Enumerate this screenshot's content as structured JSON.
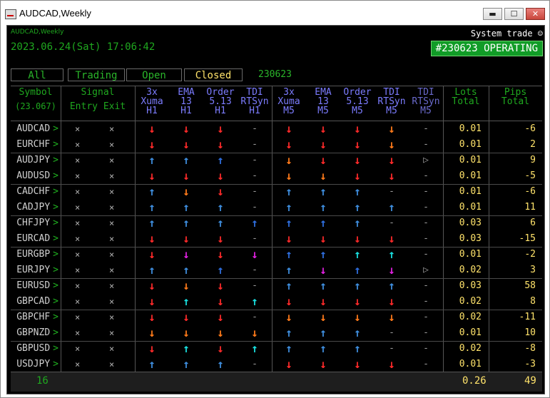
{
  "window": {
    "title": "AUDCAD,Weekly",
    "minimize": "▬",
    "maximize": "☐",
    "close": "✕"
  },
  "panel": {
    "symbol": "AUDCAD,Weekly",
    "datetime": "2023.06.24(Sat) 17:06:42",
    "system_trade": "System trade ☺",
    "operating": "#230623 OPERATING",
    "filters": [
      "All",
      "Trading",
      "Open",
      "Closed"
    ],
    "active_filter": "Closed",
    "filter_date": "230623"
  },
  "headers": {
    "symbol": [
      "Symbol",
      "(23.067)"
    ],
    "signal": [
      "Signal",
      "Entry  Exit"
    ],
    "h1": [
      [
        "3x",
        "Xuma",
        "H1"
      ],
      [
        "EMA",
        "13",
        "H1"
      ],
      [
        "Order",
        "5.13",
        "H1"
      ],
      [
        "TDI",
        "RTSyn",
        "H1"
      ]
    ],
    "m5": [
      [
        "3x",
        "Xuma",
        "M5"
      ],
      [
        "EMA",
        "13",
        "M5"
      ],
      [
        "Order",
        "5.13",
        "M5"
      ],
      [
        "TDI",
        "RTSyn",
        "M5"
      ],
      [
        "TDI",
        "RTSyn",
        "M5"
      ]
    ],
    "lots": [
      "Lots",
      "Total"
    ],
    "pips": [
      "Pips",
      "Total"
    ]
  },
  "colors": {
    "red": "#ff2a2a",
    "orange": "#ff7a1a",
    "blue": "#2f6fe0",
    "lblue": "#3f8fe0",
    "cyan": "#19e0e0",
    "magenta": "#e020e0",
    "gray": "#9a9a9a",
    "green": "#1fa81f",
    "yellow": "#ffe36b"
  },
  "rows": [
    {
      "symbol": "AUDCAD",
      "entry": "×",
      "exit": "×",
      "h1": [
        "red:↓",
        "red:↓",
        "red:↓",
        "gray:-"
      ],
      "m5": [
        "red:↓",
        "red:↓",
        "red:↓",
        "orange:↓",
        "gray:-"
      ],
      "lots": "0.01",
      "pips": "-6"
    },
    {
      "symbol": "EURCHF",
      "entry": "×",
      "exit": "×",
      "h1": [
        "red:↓",
        "red:↓",
        "red:↓",
        "gray:-"
      ],
      "m5": [
        "red:↓",
        "red:↓",
        "red:↓",
        "orange:↓",
        "gray:-"
      ],
      "lots": "0.01",
      "pips": "2"
    },
    {
      "symbol": "AUDJPY",
      "entry": "×",
      "exit": "×",
      "h1": [
        "lblue:↑",
        "lblue:↑",
        "blue:↑",
        "gray:-"
      ],
      "m5": [
        "orange:↓",
        "red:↓",
        "red:↓",
        "red:↓",
        "gray:▷"
      ],
      "lots": "0.01",
      "pips": "9"
    },
    {
      "symbol": "AUDUSD",
      "entry": "×",
      "exit": "×",
      "h1": [
        "red:↓",
        "red:↓",
        "red:↓",
        "gray:-"
      ],
      "m5": [
        "orange:↓",
        "orange:↓",
        "red:↓",
        "red:↓",
        "gray:-"
      ],
      "lots": "0.01",
      "pips": "-5"
    },
    {
      "symbol": "CADCHF",
      "entry": "×",
      "exit": "×",
      "h1": [
        "lblue:↑",
        "orange:↓",
        "red:↓",
        "gray:-"
      ],
      "m5": [
        "lblue:↑",
        "lblue:↑",
        "lblue:↑",
        "gray:-",
        "gray:-"
      ],
      "lots": "0.01",
      "pips": "-6"
    },
    {
      "symbol": "CADJPY",
      "entry": "×",
      "exit": "×",
      "h1": [
        "lblue:↑",
        "lblue:↑",
        "lblue:↑",
        "gray:-"
      ],
      "m5": [
        "lblue:↑",
        "lblue:↑",
        "lblue:↑",
        "lblue:↑",
        "gray:-"
      ],
      "lots": "0.01",
      "pips": "11"
    },
    {
      "symbol": "CHFJPY",
      "entry": "×",
      "exit": "×",
      "h1": [
        "lblue:↑",
        "lblue:↑",
        "lblue:↑",
        "blue:↑"
      ],
      "m5": [
        "blue:↑",
        "blue:↑",
        "lblue:↑",
        "gray:-",
        "gray:-"
      ],
      "lots": "0.03",
      "pips": "6"
    },
    {
      "symbol": "EURCAD",
      "entry": "×",
      "exit": "×",
      "h1": [
        "red:↓",
        "red:↓",
        "red:↓",
        "gray:-"
      ],
      "m5": [
        "red:↓",
        "red:↓",
        "red:↓",
        "red:↓",
        "gray:-"
      ],
      "lots": "0.03",
      "pips": "-15"
    },
    {
      "symbol": "EURGBP",
      "entry": "×",
      "exit": "×",
      "h1": [
        "red:↓",
        "magenta:↓",
        "red:↓",
        "magenta:↓"
      ],
      "m5": [
        "blue:↑",
        "blue:↑",
        "cyan:↑",
        "cyan:↑",
        "gray:-"
      ],
      "lots": "0.01",
      "pips": "-2"
    },
    {
      "symbol": "EURJPY",
      "entry": "×",
      "exit": "×",
      "h1": [
        "lblue:↑",
        "lblue:↑",
        "blue:↑",
        "gray:-"
      ],
      "m5": [
        "lblue:↑",
        "magenta:↓",
        "blue:↑",
        "magenta:↓",
        "gray:▷"
      ],
      "lots": "0.02",
      "pips": "3"
    },
    {
      "symbol": "EURUSD",
      "entry": "×",
      "exit": "×",
      "h1": [
        "red:↓",
        "orange:↓",
        "red:↓",
        "gray:-"
      ],
      "m5": [
        "lblue:↑",
        "lblue:↑",
        "lblue:↑",
        "lblue:↑",
        "gray:-"
      ],
      "lots": "0.03",
      "pips": "58"
    },
    {
      "symbol": "GBPCAD",
      "entry": "×",
      "exit": "×",
      "h1": [
        "red:↓",
        "cyan:↑",
        "red:↓",
        "cyan:↑"
      ],
      "m5": [
        "red:↓",
        "red:↓",
        "red:↓",
        "red:↓",
        "gray:-"
      ],
      "lots": "0.02",
      "pips": "8"
    },
    {
      "symbol": "GBPCHF",
      "entry": "×",
      "exit": "×",
      "h1": [
        "red:↓",
        "red:↓",
        "red:↓",
        "gray:-"
      ],
      "m5": [
        "orange:↓",
        "orange:↓",
        "orange:↓",
        "orange:↓",
        "gray:-"
      ],
      "lots": "0.02",
      "pips": "-11"
    },
    {
      "symbol": "GBPNZD",
      "entry": "×",
      "exit": "×",
      "h1": [
        "orange:↓",
        "orange:↓",
        "orange:↓",
        "orange:↓"
      ],
      "m5": [
        "lblue:↑",
        "lblue:↑",
        "lblue:↑",
        "gray:-",
        "gray:-"
      ],
      "lots": "0.01",
      "pips": "10"
    },
    {
      "symbol": "GBPUSD",
      "entry": "×",
      "exit": "×",
      "h1": [
        "red:↓",
        "cyan:↑",
        "red:↓",
        "cyan:↑"
      ],
      "m5": [
        "lblue:↑",
        "lblue:↑",
        "lblue:↑",
        "gray:-",
        "gray:-"
      ],
      "lots": "0.02",
      "pips": "-8"
    },
    {
      "symbol": "USDJPY",
      "entry": "×",
      "exit": "×",
      "h1": [
        "lblue:↑",
        "lblue:↑",
        "lblue:↑",
        "gray:-"
      ],
      "m5": [
        "red:↓",
        "red:↓",
        "red:↓",
        "red:↓",
        "gray:-"
      ],
      "lots": "0.01",
      "pips": "-3"
    }
  ],
  "totals": {
    "count": "16",
    "lots": "0.26",
    "pips": "49"
  }
}
